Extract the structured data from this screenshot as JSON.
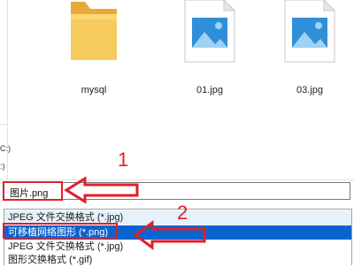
{
  "navigation": {
    "items": [
      "C:)",
      ":)"
    ]
  },
  "files": [
    {
      "name": "mysql",
      "icon": "folder-icon"
    },
    {
      "name": "01.jpg",
      "icon": "image-file-icon"
    },
    {
      "name": "03.jpg",
      "icon": "image-file-icon"
    }
  ],
  "filename_field": {
    "value": "图片.png"
  },
  "file_type_options": [
    {
      "label": "JPEG 文件交换格式 (*.jpg)",
      "state": "hover"
    },
    {
      "label": "可移植网络图形 (*.png)",
      "state": "selected"
    },
    {
      "label": "JPEG 文件交换格式 (*.jpg)",
      "state": "normal"
    },
    {
      "label": "图形交换格式 (*.gif)",
      "state": "normal"
    }
  ],
  "annotations": {
    "step1": "1",
    "step2": "2",
    "color": "#e01e2a"
  },
  "colors": {
    "selection": "#0a64cd",
    "hover": "#e5f1fb",
    "folder": "#f5c550"
  }
}
